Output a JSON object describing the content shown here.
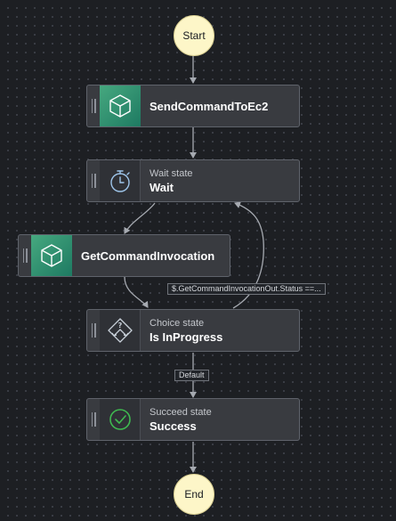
{
  "workflow": {
    "start": {
      "label": "Start"
    },
    "end": {
      "label": "End"
    },
    "states": {
      "send_command": {
        "title": "SendCommandToEc2",
        "icon": "cube-icon"
      },
      "wait": {
        "subtitle": "Wait state",
        "title": "Wait",
        "icon": "stopwatch-icon"
      },
      "get_invocation": {
        "title": "GetCommandInvocation",
        "icon": "cube-icon"
      },
      "choice": {
        "subtitle": "Choice state",
        "title": "Is InProgress",
        "icon": "choice-diamond-icon"
      },
      "success": {
        "subtitle": "Succeed state",
        "title": "Success",
        "icon": "check-circle-icon"
      }
    },
    "edge_labels": {
      "loop_condition": "$.GetCommandInvocationOut.Status ==...",
      "default": "Default"
    },
    "colors": {
      "terminal_fill": "#fdf6c8",
      "task_icon_bg": "#2f8f6f",
      "success_icon": "#2ea043",
      "node_bg": "#393b40"
    }
  }
}
